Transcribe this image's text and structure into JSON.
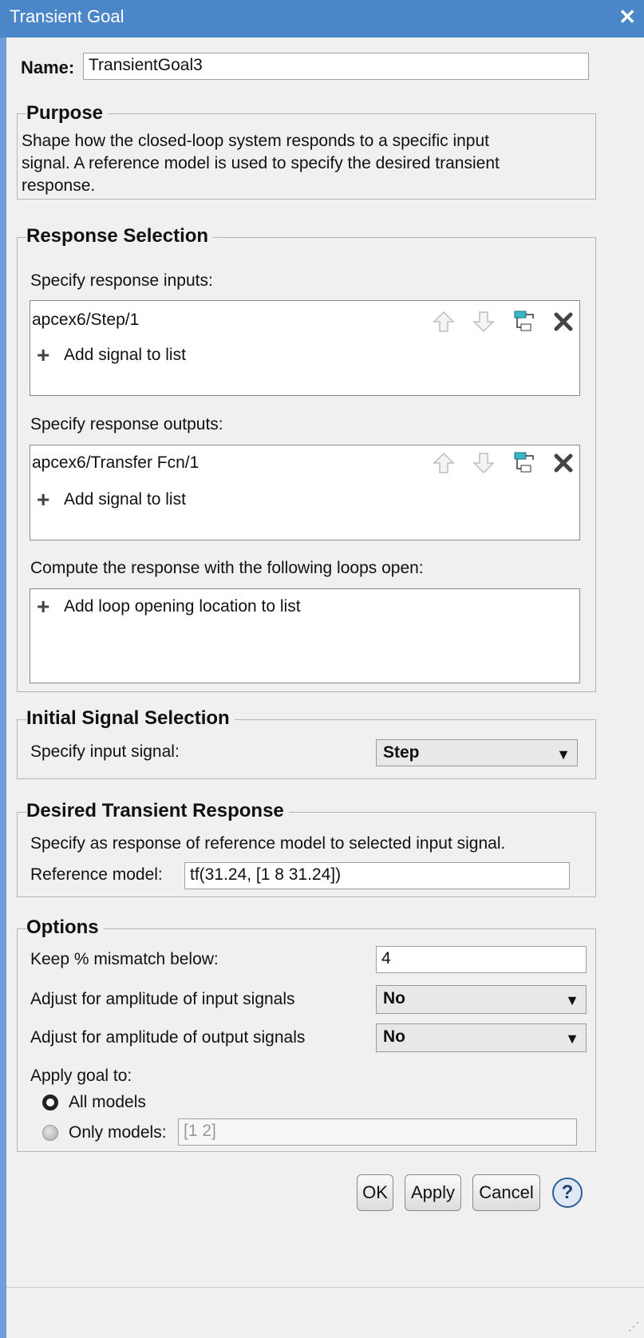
{
  "window": {
    "title": "Transient Goal",
    "close_icon": "close-icon"
  },
  "name_field": {
    "label": "Name:",
    "value": "TransientGoal3"
  },
  "purpose": {
    "title": "Purpose",
    "line1": "Shape how the closed-loop system responds to a specific input",
    "line2": "signal. A reference model is used to specify the desired transient",
    "line3": "response."
  },
  "response_selection": {
    "title": "Response Selection",
    "inputs_label": "Specify response inputs:",
    "inputs_items": [
      "apcex6/Step/1"
    ],
    "outputs_label": "Specify response outputs:",
    "outputs_items": [
      "apcex6/Transfer Fcn/1"
    ],
    "add_signal_label": "Add signal to list",
    "loops_label": "Compute the response with the following loops open:",
    "add_loop_label": "Add loop opening location to list"
  },
  "initial_signal": {
    "title": "Initial Signal Selection",
    "label": "Specify input signal:",
    "value": "Step"
  },
  "desired_response": {
    "title": "Desired Transient Response",
    "description": "Specify as response of reference model to selected input signal.",
    "ref_label": "Reference model:",
    "ref_value": "tf(31.24, [1 8 31.24])"
  },
  "options": {
    "title": "Options",
    "mismatch_label": "Keep % mismatch below:",
    "mismatch_value": "4",
    "adjust_input_label": "Adjust for amplitude of input signals",
    "adjust_input_value": "No",
    "adjust_output_label": "Adjust for amplitude of output signals",
    "adjust_output_value": "No",
    "apply_label": "Apply goal to:",
    "all_models_label": "All models",
    "only_models_label": "Only models:",
    "only_models_value": "[1 2]",
    "selected": "all_models"
  },
  "buttons": {
    "ok": "OK",
    "apply": "Apply",
    "cancel": "Cancel",
    "help": "?"
  },
  "colors": {
    "titlebar": "#4a86c8",
    "accent": "#2d5f99"
  }
}
